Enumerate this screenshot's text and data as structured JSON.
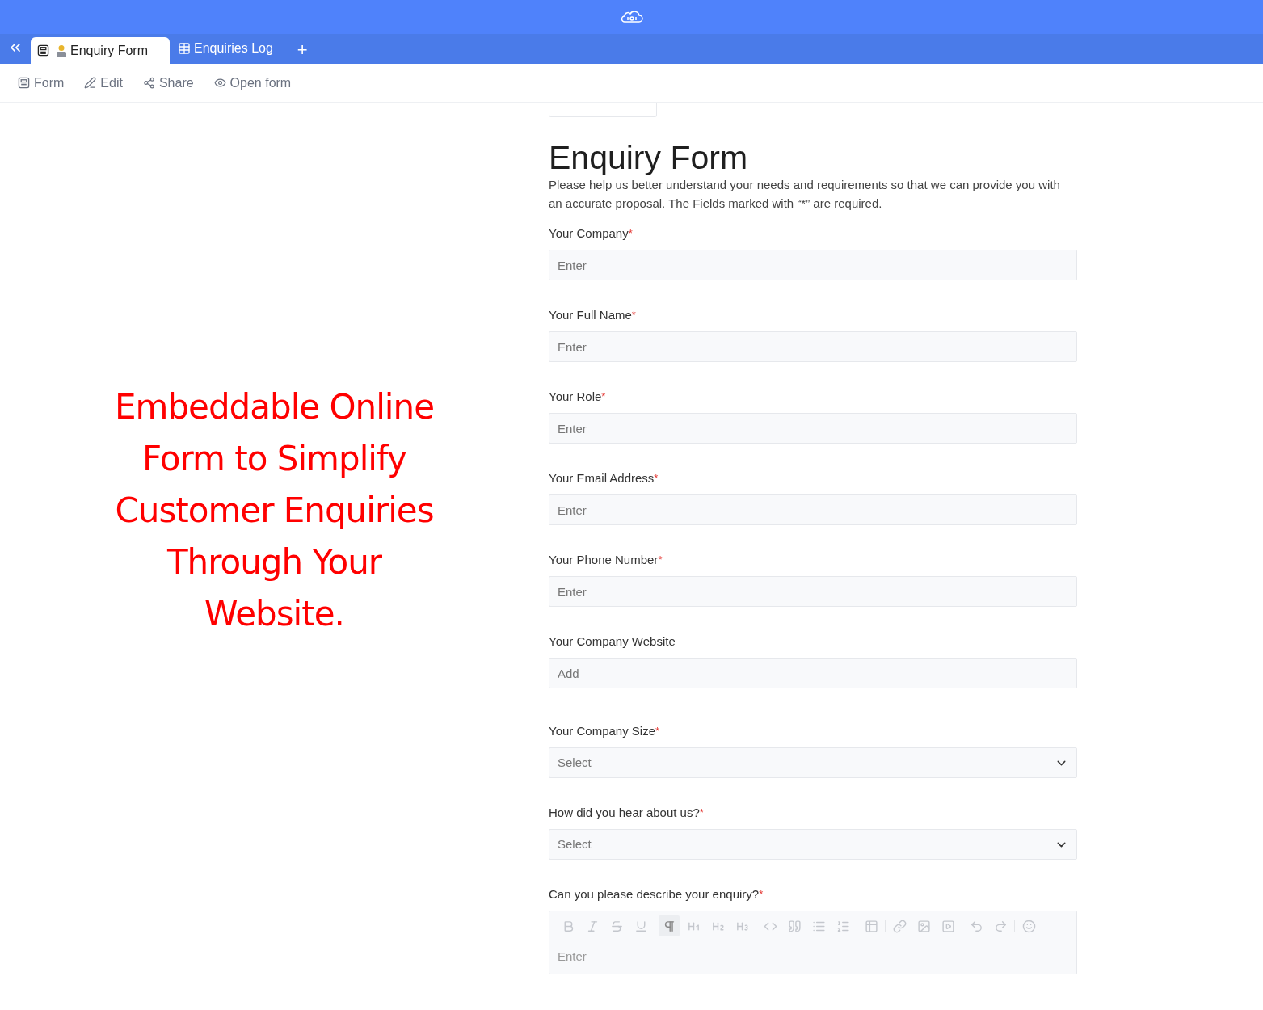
{
  "tabs": [
    {
      "label": "Enquiry Form",
      "kind": "form",
      "selected": true
    },
    {
      "label": "Enquiries Log",
      "kind": "table",
      "selected": false
    }
  ],
  "add_tab": "+",
  "toolbar": [
    {
      "label": "Form",
      "kind": "form"
    },
    {
      "label": "Edit",
      "kind": "edit"
    },
    {
      "label": "Share",
      "kind": "share"
    },
    {
      "label": "Open form",
      "kind": "open"
    }
  ],
  "caption": "Embeddable Online Form to Simplify Customer Enquiries Through Your Website.",
  "form": {
    "title": "Enquiry Form",
    "description": "Please help us better understand your needs and requirements so that we can provide you with an accurate proposal. The Fields marked with “*” are required.",
    "fields": [
      {
        "label": "Your Company",
        "required_mark": "*",
        "kind": "text",
        "placeholder": "Enter"
      },
      {
        "label": "Your Full Name",
        "required_mark": "*",
        "kind": "text",
        "placeholder": "Enter"
      },
      {
        "label": "Your Role",
        "required_mark": "*",
        "kind": "text",
        "placeholder": "Enter"
      },
      {
        "label": "Your Email Address",
        "required_mark": "*",
        "kind": "text",
        "placeholder": "Enter"
      },
      {
        "label": "Your Phone Number",
        "required_mark": "*",
        "kind": "text",
        "placeholder": "Enter"
      },
      {
        "label": "Your Company Website",
        "kind": "text",
        "placeholder": "Add"
      },
      {
        "label": "Your Company Size",
        "required_mark": "*",
        "kind": "select",
        "placeholder": "Select"
      },
      {
        "label": "How did you hear about us?",
        "required_mark": "*",
        "kind": "select",
        "placeholder": "Select"
      },
      {
        "label": "Can you please describe your enquiry?",
        "required_mark": "*",
        "kind": "richtext",
        "placeholder": "Enter",
        "tools": [
          {
            "kind": "bold",
            "selected": false
          },
          {
            "kind": "italic",
            "selected": false
          },
          {
            "kind": "strike",
            "selected": false
          },
          {
            "kind": "underline",
            "selected": false
          },
          {
            "kind": "paragraph",
            "selected": true
          },
          {
            "kind": "h1",
            "selected": false
          },
          {
            "kind": "h2",
            "selected": false
          },
          {
            "kind": "h3",
            "selected": false
          },
          {
            "kind": "code",
            "selected": false
          },
          {
            "kind": "quote",
            "selected": false
          },
          {
            "kind": "bullets",
            "selected": false
          },
          {
            "kind": "numbers",
            "selected": false
          },
          {
            "kind": "table",
            "selected": false
          },
          {
            "kind": "link",
            "selected": false
          },
          {
            "kind": "image",
            "selected": false
          },
          {
            "kind": "video",
            "selected": false
          },
          {
            "kind": "undo",
            "selected": false
          },
          {
            "kind": "redo",
            "selected": false
          },
          {
            "kind": "emoji",
            "selected": false
          }
        ]
      }
    ]
  }
}
